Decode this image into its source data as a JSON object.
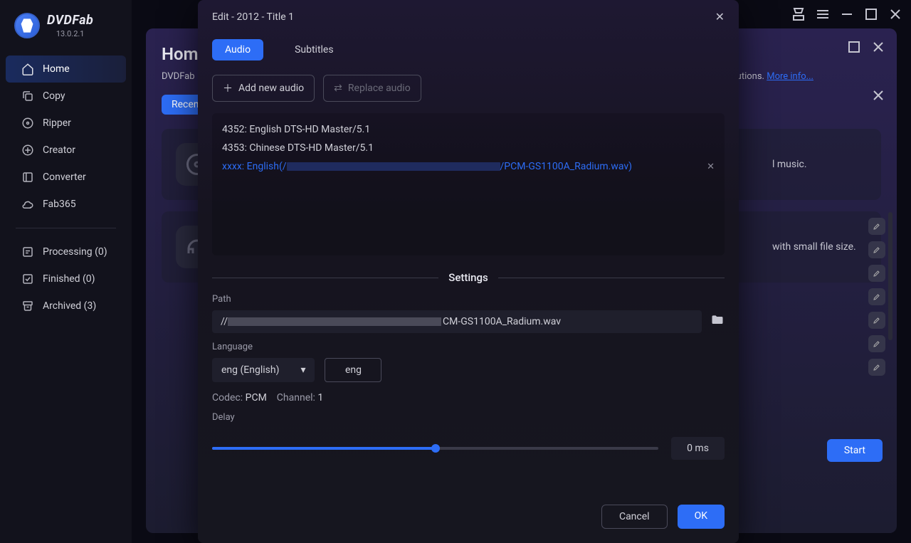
{
  "app": {
    "name": "DVDFab",
    "version": "13.0.2.1"
  },
  "sidebar": {
    "items": [
      {
        "label": "Home"
      },
      {
        "label": "Copy"
      },
      {
        "label": "Ripper"
      },
      {
        "label": "Creator"
      },
      {
        "label": "Converter"
      },
      {
        "label": "Fab365"
      }
    ],
    "queue": [
      {
        "label": "Processing (0)"
      },
      {
        "label": "Finished (0)"
      },
      {
        "label": "Archived (3)"
      }
    ]
  },
  "home": {
    "title": "Home",
    "desc_prefix": "DVDFab ",
    "desc_suffix": "al soulutions. ",
    "more_link": "More info...",
    "recent": "Recen",
    "card1_text": "l music.",
    "card2_text": " with small file size.",
    "start": "Start"
  },
  "modal": {
    "title": "Edit - 2012 - Title 1",
    "tabs": {
      "audio": "Audio",
      "subtitles": "Subtitles"
    },
    "add_audio": "Add new audio",
    "replace_audio": "Replace audio",
    "tracks": [
      "4352: English DTS-HD Master/5.1",
      "4353: Chinese DTS-HD Master/5.1"
    ],
    "track_sel_prefix": "xxxx: English(/",
    "track_sel_suffix": "/PCM-GS1100A_Radium.wav)",
    "settings_label": "Settings",
    "path_label": "Path",
    "path_prefix": "//",
    "path_suffix": "CM-GS1100A_Radium.wav",
    "language_label": "Language",
    "language_select": "eng (English)",
    "language_code": "eng",
    "codec_label": "Codec:",
    "codec_value": "PCM",
    "channel_label": "Channel:",
    "channel_value": "1",
    "delay_label": "Delay",
    "delay_value": "0 ms",
    "cancel": "Cancel",
    "ok": "OK"
  }
}
